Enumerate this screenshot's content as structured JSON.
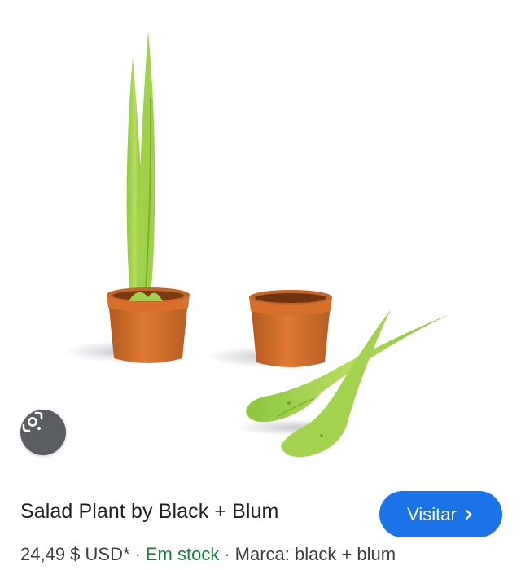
{
  "product": {
    "title": "Salad Plant by Black + Blum",
    "price": "24,49 $ USD*",
    "separator": "·",
    "stock": "Em stock",
    "brand": "Marca: black + blum"
  },
  "actions": {
    "visit_label": "Visitar",
    "visit_icon": "chevron-right-icon",
    "lens_icon": "google-lens-icon"
  },
  "colors": {
    "accent": "#1a73e8",
    "stock": "#188038"
  }
}
